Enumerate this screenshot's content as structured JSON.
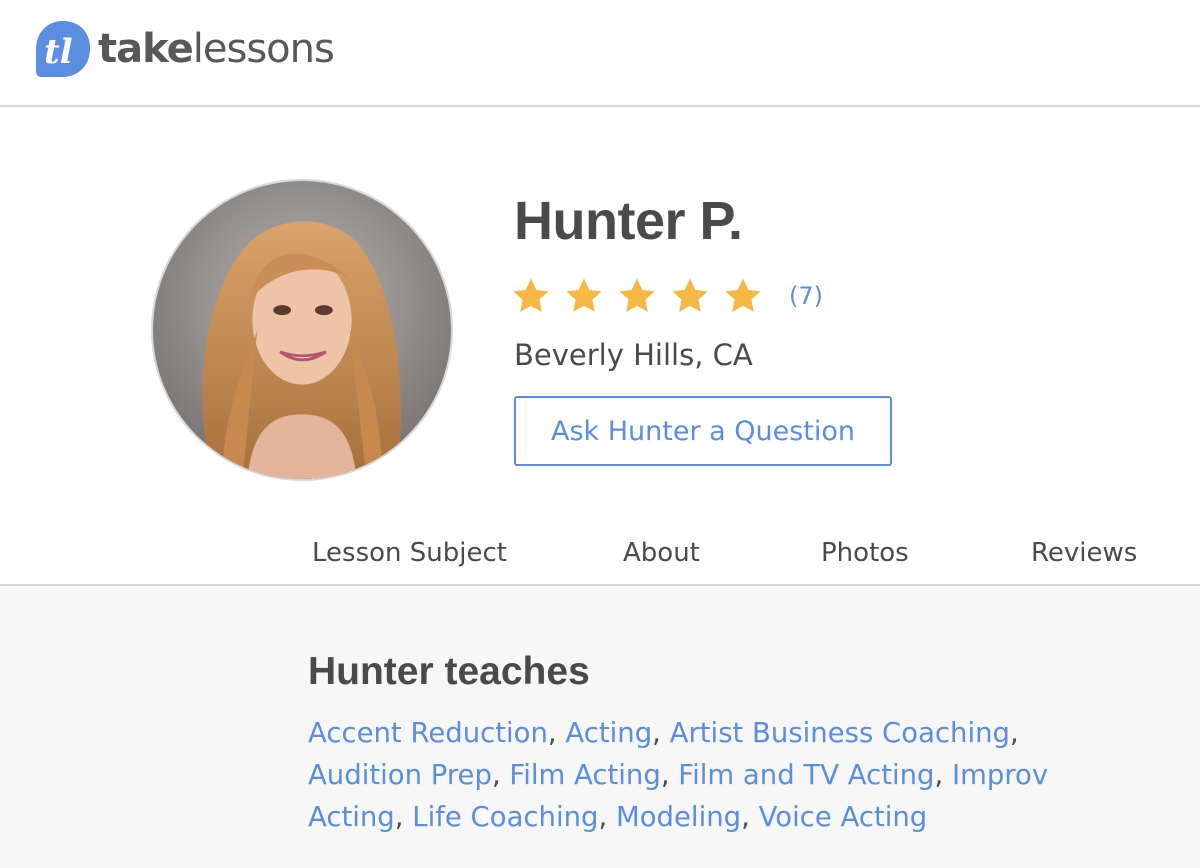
{
  "header": {
    "logo_bold": "take",
    "logo_light": "lessons",
    "logo_mark_text": "tl"
  },
  "profile": {
    "name": "Hunter P.",
    "rating_stars": 5,
    "review_count": "(7)",
    "location": "Beverly Hills, CA",
    "ask_button": "Ask Hunter a Question"
  },
  "tabs": [
    {
      "label": "Lesson Subject",
      "active": true
    },
    {
      "label": "About",
      "active": false
    },
    {
      "label": "Photos",
      "active": false
    },
    {
      "label": "Reviews",
      "active": false
    }
  ],
  "teaches": {
    "title": "Hunter teaches",
    "subjects": [
      "Accent Reduction",
      "Acting",
      "Artist Business Coaching",
      "Audition Prep",
      "Film Acting",
      "Film and TV Acting",
      "Improv Acting",
      "Life Coaching",
      "Modeling",
      "Voice Acting"
    ],
    "separator": ", "
  },
  "colors": {
    "link": "#5b8de0",
    "star": "#f4b944",
    "text": "#4a4a4a",
    "logo_blue": "#5b8de0"
  }
}
